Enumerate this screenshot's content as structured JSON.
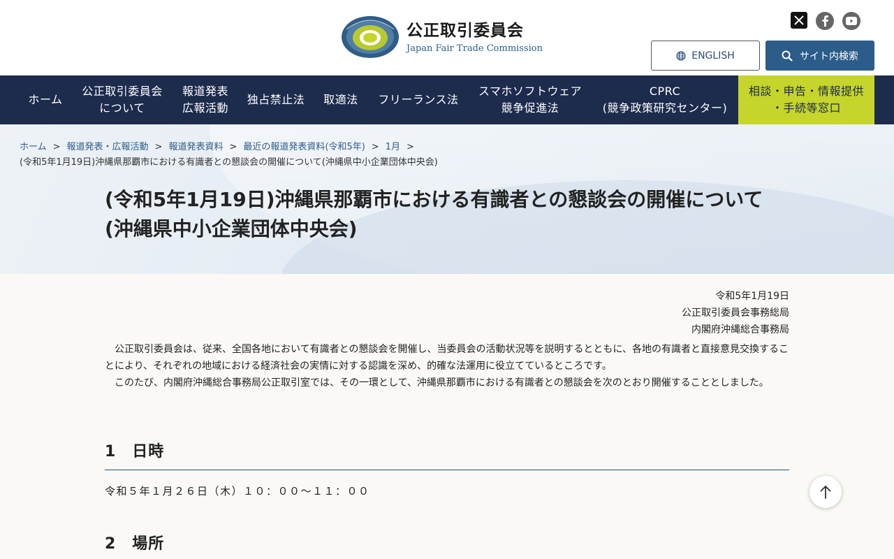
{
  "header": {
    "org_name_jp": "公正取引委員会",
    "org_name_en": "Japan Fair Trade Commission",
    "english_label": "ENGLISH",
    "search_label": "サイト内検索"
  },
  "sns": {
    "icons": [
      "x-icon",
      "facebook-icon",
      "youtube-icon"
    ]
  },
  "nav": {
    "home": "ホーム",
    "about_1": "公正取引委員会",
    "about_2": "について",
    "press_1": "報道発表",
    "press_2": "広報活動",
    "antimonopoly": "独占禁止法",
    "subcontract": "取適法",
    "freelance": "フリーランス法",
    "smartphone_1": "スマホソフトウェア",
    "smartphone_2": "競争促進法",
    "cprc_1": "CPRC",
    "cprc_2": "(競争政策研究センター)",
    "consult_1": "相談・申告・情報提供",
    "consult_2": "・手続等窓口"
  },
  "breadcrumb": {
    "items": [
      "ホーム",
      "報道発表・広報活動",
      "報道発表資料",
      "最近の報道発表資料(令和5年)",
      "1月"
    ],
    "current": "(令和5年1月19日)沖縄県那覇市における有識者との懇談会の開催について(沖縄県中小企業団体中央会)"
  },
  "page": {
    "title": "(令和5年1月19日)沖縄県那覇市における有識者との懇談会の開催について(沖縄県中小企業団体中央会)"
  },
  "content": {
    "date": "令和5年1月19日",
    "issuer_1": "公正取引委員会事務総局",
    "issuer_2": "内閣府沖縄総合事務局",
    "paragraph_1": "公正取引委員会は、従来、全国各地において有識者との懇談会を開催し、当委員会の活動状況等を説明するとともに、各地の有識者と直接意見交換することにより、それぞれの地域における経済社会の実情に対する認識を深め、的確な法運用に役立てているところです。",
    "paragraph_2": "このたび、内閣府沖縄総合事務局公正取引室では、その一環として、沖縄県那覇市における有識者との懇談会を次のとおり開催することとしました。",
    "section_1_heading": "1　日時",
    "section_1_text": "令和５年１月２６日（木）１０：００～１１：００",
    "section_2_heading": "2　場所"
  },
  "colors": {
    "nav_bg": "#1d2b4d",
    "consult_bg": "#c5d52b",
    "search_btn_bg": "#2b5c8a",
    "link": "#2b5c8a"
  }
}
